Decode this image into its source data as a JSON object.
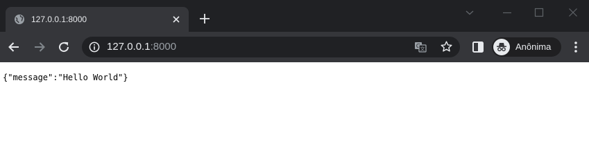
{
  "tab": {
    "title": "127.0.0.1:8000",
    "favicon": "globe-icon"
  },
  "address_bar": {
    "host": "127.0.0.1",
    "port": ":8000"
  },
  "profile": {
    "label": "Anônima",
    "icon": "incognito-icon"
  },
  "page": {
    "body_text": "{\"message\":\"Hello World\"}"
  },
  "colors": {
    "tab_strip": "#202124",
    "toolbar": "#35363a",
    "omnibox": "#202124",
    "text_light": "#e8eaed",
    "text_dim": "#9aa0a6"
  }
}
